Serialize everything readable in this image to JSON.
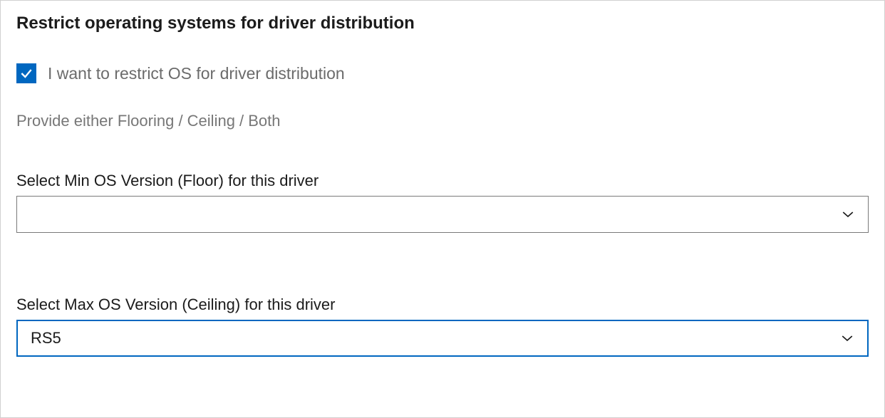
{
  "heading": "Restrict operating systems for driver distribution",
  "checkbox": {
    "checked": true,
    "label": "I want to restrict OS for driver distribution"
  },
  "hint": "Provide either Flooring / Ceiling / Both",
  "minField": {
    "label": "Select Min OS Version (Floor) for this driver",
    "value": ""
  },
  "maxField": {
    "label": "Select Max OS Version (Ceiling) for this driver",
    "value": "RS5"
  }
}
